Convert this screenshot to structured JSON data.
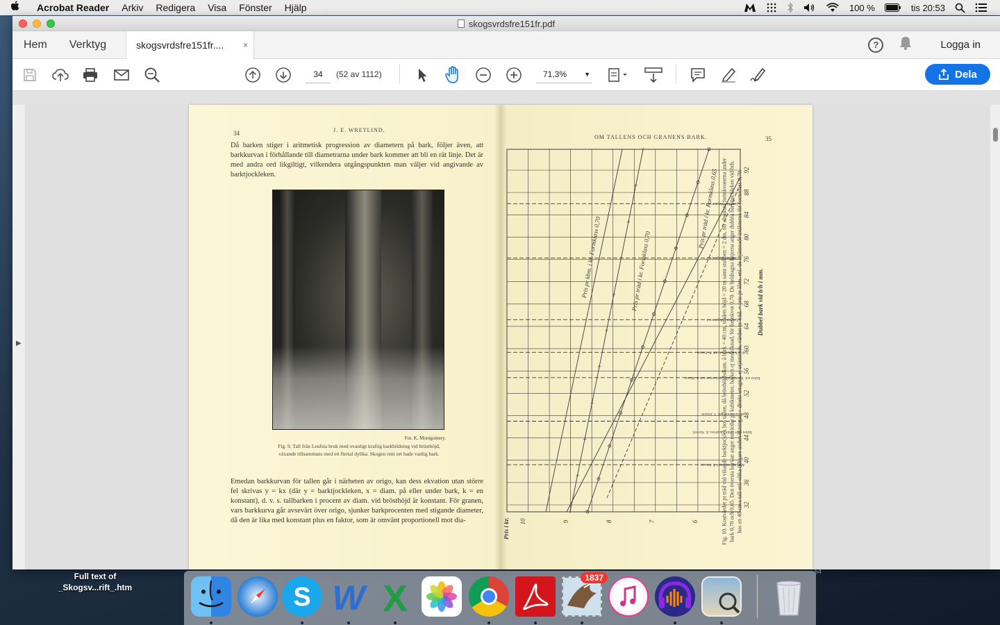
{
  "menubar": {
    "app_name": "Acrobat Reader",
    "menus": [
      "Arkiv",
      "Redigera",
      "Visa",
      "Fönster",
      "Hjälp"
    ],
    "battery": "100 %",
    "clock": "tis 20:53"
  },
  "window": {
    "title": "skogsvrdsfre151fr.pdf",
    "nav_tabs": [
      "Hem",
      "Verktyg"
    ],
    "doc_tab": "skogsvrdsfre151fr....",
    "doc_tab_close": "×",
    "help": "?",
    "login": "Logga in"
  },
  "toolbar": {
    "page_input": "34",
    "page_count": "(52 av 1112)",
    "zoom": "71,3%",
    "share_label": "Dela"
  },
  "document": {
    "left_page": {
      "page_number": "34",
      "running_head": "J. E. WRETLIND.",
      "paragraph1": "Då barken stiger i aritmetisk progression av diametern på bark, följer även, att barkkurvan i förhållande till diametrarna under bark kommer att bli en rät linje. Det är med andra ord likgiltigt, vilkendera utgångspunkten man väljer vid angivande av barktjockleken.",
      "photo_credit": "Fot. K. Montgomery.",
      "caption": "Fig. 9. Tall från Leufsta bruk med ovanligt kraftig barkbildning vid brösthöjd, växande tillsammans med ett flertal dylika. Skogen rent ort hade vanlig bark.",
      "paragraph2": "Emedan barkkurvan för tallen går i närheten av origo, kan dess ekvation utan större fel skrivas y = kx (där y = barktjockleken, x = diam. på eller under bark, k = en konstant), d. v. s. tallbarken i procent av diam. vid brösthöjd är konstant. För granen, vars barkkurva går avsevärt över origo, sjunker barkprocenten med stigande diameter, då den är lika med konstant plus en faktor, som är omvänt proportionell mot dia-"
    },
    "right_page": {
      "page_number": "35",
      "running_head": "OM TALLENS OCH GRANENS BARK.",
      "axis_label": "Dubbel bark vid b/h i mm.",
      "axis_label_price": "Pris i kr.",
      "tick_labels": [
        "32",
        "36",
        "40",
        "44",
        "48",
        "52",
        "56",
        "60",
        "64",
        "68",
        "72",
        "76",
        "80",
        "84",
        "88",
        "92"
      ],
      "price_ticks": [
        "10",
        "9",
        "8",
        "7",
        "6"
      ],
      "line_labels": [
        "Pris pr kbm. i kr. Formklass 0,70",
        "Pris pr träd i kr. Formklass 0,70",
        "Pris pr träd i kr. Formklass 0,65"
      ],
      "row_labels": [
        "Leufsta tallage n:o 3",
        "Leufsta tallage n:o 2",
        "Leufsta tallage n:o 1",
        "Syd- och ostsvensk tall. F. Jonson.",
        "Tallen enl. Värmländska revisionen och A. Maass.",
        "Medelsvensk tall. T. Jonson.",
        "Tallen efter nedre Dalälven. E. Norrell.",
        "Mellansvensk tall. T. Jonson."
      ],
      "vertical_caption": "Fig. 10. Kostvärdet pr träd vid vikande barktjocklek hos tallen, då brösthöjdsdiam. å bark = 40 cm, trädets höjd = 20 m samt stubben = 2 dm, för absoluta formkvoterna under bark 0,70 och 0,65. Den översta kurvan anger rotvärdet pr kubikmeter, barken ej medräknad, för formkvot 0,70. De heldragna linjerna anger dubbla barktjockleken vid brh. hos en 40 cm:s tall enl. olika tidigare undersökningar. ○ direkt uttagna, ej utjämnade, värden pr träd. + pris pr kbm. enl. de utjämnade intäkterna för formklass 0,70."
    }
  },
  "dock": {
    "desktop_file_label": "Full text of _Skogsv...rift_.htm",
    "edge_number": "64",
    "mail_badge": "1837",
    "apps": [
      "Finder",
      "Safari",
      "Skype",
      "Word",
      "Excel",
      "Photos",
      "Chrome",
      "Acrobat Reader",
      "Mail",
      "iTunes",
      "Audacity",
      "Preview",
      "Trash"
    ]
  },
  "colors": {
    "share_button": "#1473e6",
    "page_background": "#f8f2cf",
    "hand_tool_active": "#1473e6"
  }
}
